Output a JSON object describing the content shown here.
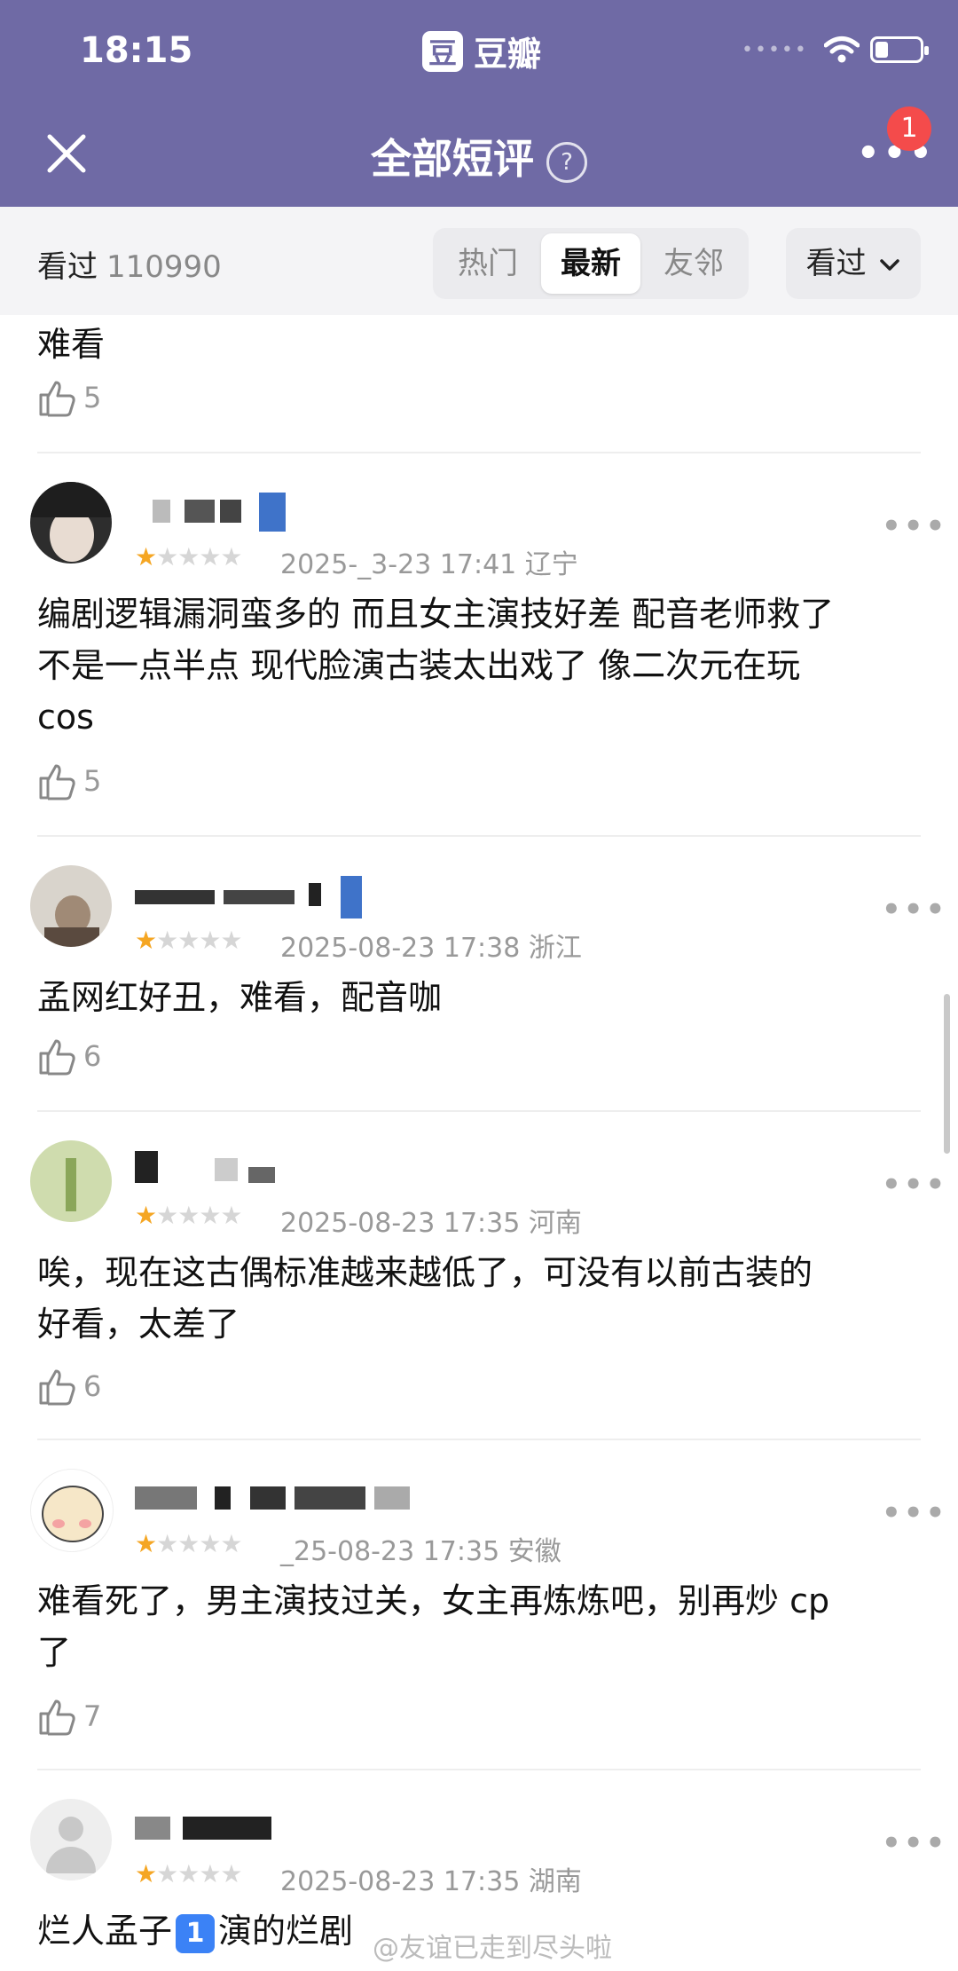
{
  "status_bar": {
    "time": "18:15",
    "app_name": "豆瓣",
    "app_logo_char": "豆",
    "signal": "•••••"
  },
  "nav": {
    "title": "全部短评",
    "help": "?",
    "more": "•••",
    "notification_count": "1",
    "accent_color": "#6f6aa5"
  },
  "filter": {
    "watched_label": "看过",
    "watched_count": "110990",
    "tabs": [
      "热门",
      "最新",
      "友邻"
    ],
    "active_tab": "最新",
    "dropdown": "看过"
  },
  "comments": [
    {
      "text": "难看",
      "likes": "5"
    },
    {
      "rating": 1,
      "meta": "2025-_3-23 17:41 辽宁",
      "text_lines": [
        "编剧逻辑漏洞蛮多的 而且女主演技好差 配音老师救了",
        "不是一点半点  现代脸演古装太出戏了 像二次元在玩",
        "cos"
      ],
      "likes": "5"
    },
    {
      "rating": 1,
      "meta": "2025-08-23 17:38 浙江",
      "text_lines": [
        "孟网红好丑，难看，配音咖"
      ],
      "likes": "6"
    },
    {
      "rating": 1,
      "meta": "2025-08-23 17:35 河南",
      "text_lines": [
        "唉，现在这古偶标准越来越低了，可没有以前古装的",
        "好看，太差了"
      ],
      "likes": "6"
    },
    {
      "rating": 1,
      "meta": "_25-08-23 17:35 安徽",
      "text_lines": [
        "难看死了，男主演技过关，女主再炼炼吧，别再炒 cp",
        "了"
      ],
      "likes": "7"
    },
    {
      "rating": 1,
      "meta": "2025-08-23 17:35 湖南",
      "text_before": "烂人孟子",
      "emoji": "1",
      "text_after": "演的烂剧"
    }
  ],
  "watermark": "@友谊已走到尽头啦"
}
